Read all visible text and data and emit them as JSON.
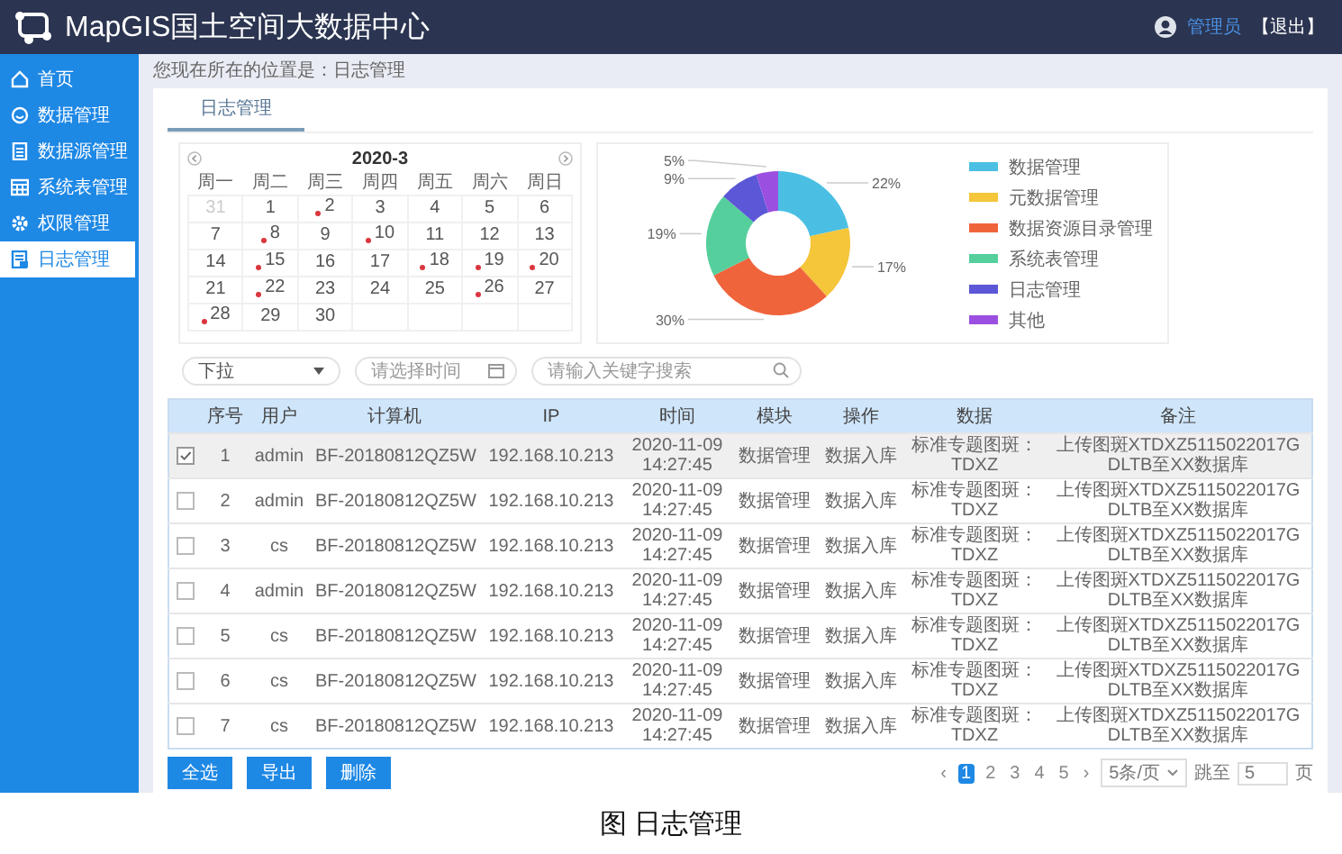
{
  "header": {
    "title": "MapGIS国土空间大数据中心",
    "user": "管理员",
    "logout": "【退出】"
  },
  "sidebar": {
    "items": [
      {
        "label": "首页",
        "selected": false
      },
      {
        "label": "数据管理",
        "selected": false
      },
      {
        "label": "数据源管理",
        "selected": false
      },
      {
        "label": "系统表管理",
        "selected": false
      },
      {
        "label": "权限管理",
        "selected": false
      },
      {
        "label": "日志管理",
        "selected": true
      }
    ]
  },
  "breadcrumb": "您现在所在的位置是：日志管理",
  "tabs": [
    {
      "label": "日志管理",
      "selected": true
    }
  ],
  "calendar": {
    "title": "2020-3",
    "weekdays": [
      "周一",
      "周二",
      "周三",
      "周四",
      "周五",
      "周六",
      "周日"
    ],
    "days": [
      {
        "day": "31",
        "outside": true,
        "marked": false
      },
      {
        "day": "1",
        "outside": false,
        "marked": false
      },
      {
        "day": "2",
        "outside": false,
        "marked": true
      },
      {
        "day": "3",
        "outside": false,
        "marked": false
      },
      {
        "day": "4",
        "outside": false,
        "marked": false
      },
      {
        "day": "5",
        "outside": false,
        "marked": false
      },
      {
        "day": "6",
        "outside": false,
        "marked": false
      },
      {
        "day": "7",
        "outside": false,
        "marked": false
      },
      {
        "day": "8",
        "outside": false,
        "marked": true
      },
      {
        "day": "9",
        "outside": false,
        "marked": false
      },
      {
        "day": "10",
        "outside": false,
        "marked": true
      },
      {
        "day": "11",
        "outside": false,
        "marked": false
      },
      {
        "day": "12",
        "outside": false,
        "marked": false
      },
      {
        "day": "13",
        "outside": false,
        "marked": false
      },
      {
        "day": "14",
        "outside": false,
        "marked": false
      },
      {
        "day": "15",
        "outside": false,
        "marked": true
      },
      {
        "day": "16",
        "outside": false,
        "marked": false
      },
      {
        "day": "17",
        "outside": false,
        "marked": false
      },
      {
        "day": "18",
        "outside": false,
        "marked": true
      },
      {
        "day": "19",
        "outside": false,
        "marked": true
      },
      {
        "day": "20",
        "outside": false,
        "marked": true
      },
      {
        "day": "21",
        "outside": false,
        "marked": false
      },
      {
        "day": "22",
        "outside": false,
        "marked": true
      },
      {
        "day": "23",
        "outside": false,
        "marked": false
      },
      {
        "day": "24",
        "outside": false,
        "marked": false
      },
      {
        "day": "25",
        "outside": false,
        "marked": false
      },
      {
        "day": "26",
        "outside": false,
        "marked": true
      },
      {
        "day": "27",
        "outside": false,
        "marked": false
      },
      {
        "day": "28",
        "outside": false,
        "marked": true
      },
      {
        "day": "29",
        "outside": false,
        "marked": false
      },
      {
        "day": "30",
        "outside": false,
        "marked": false
      }
    ]
  },
  "pie": {
    "chart_data": {
      "type": "donut",
      "categories": [
        "数据管理",
        "元数据管理",
        "数据资源目录管理",
        "系统表管理",
        "日志管理",
        "其他"
      ],
      "values": [
        22,
        17,
        30,
        19,
        9,
        5
      ],
      "colors": [
        "#4bbfe3",
        "#f5c53a",
        "#f0643c",
        "#55cf9c",
        "#5b57d6",
        "#9b4fe0"
      ],
      "value_labels": [
        "22%",
        "17%",
        "30%",
        "19%",
        "9%",
        "5%"
      ]
    }
  },
  "filters": {
    "dropdown": "下拉",
    "date_placeholder": "请选择时间",
    "search_placeholder": "请输入关键字搜索"
  },
  "table": {
    "columns": [
      "序号",
      "用户",
      "计算机",
      "IP",
      "时间",
      "模块",
      "操作",
      "数据",
      "备注"
    ],
    "rows": [
      {
        "checked": true,
        "cells": [
          "1",
          "admin",
          "BF-20180812QZ5W",
          "192.168.10.213",
          "2020-11-09 14:27:45",
          "数据管理",
          "数据入库",
          "标准专题图斑：TDXZ",
          "上传图斑XTDXZ5115022017GDLTB至XX数据库"
        ]
      },
      {
        "checked": false,
        "cells": [
          "2",
          "admin",
          "BF-20180812QZ5W",
          "192.168.10.213",
          "2020-11-09 14:27:45",
          "数据管理",
          "数据入库",
          "标准专题图斑：TDXZ",
          "上传图斑XTDXZ5115022017GDLTB至XX数据库"
        ]
      },
      {
        "checked": false,
        "cells": [
          "3",
          "cs",
          "BF-20180812QZ5W",
          "192.168.10.213",
          "2020-11-09 14:27:45",
          "数据管理",
          "数据入库",
          "标准专题图斑：TDXZ",
          "上传图斑XTDXZ5115022017GDLTB至XX数据库"
        ]
      },
      {
        "checked": false,
        "cells": [
          "4",
          "admin",
          "BF-20180812QZ5W",
          "192.168.10.213",
          "2020-11-09 14:27:45",
          "数据管理",
          "数据入库",
          "标准专题图斑：TDXZ",
          "上传图斑XTDXZ5115022017GDLTB至XX数据库"
        ]
      },
      {
        "checked": false,
        "cells": [
          "5",
          "cs",
          "BF-20180812QZ5W",
          "192.168.10.213",
          "2020-11-09 14:27:45",
          "数据管理",
          "数据入库",
          "标准专题图斑：TDXZ",
          "上传图斑XTDXZ5115022017GDLTB至XX数据库"
        ]
      },
      {
        "checked": false,
        "cells": [
          "6",
          "cs",
          "BF-20180812QZ5W",
          "192.168.10.213",
          "2020-11-09 14:27:45",
          "数据管理",
          "数据入库",
          "标准专题图斑：TDXZ",
          "上传图斑XTDXZ5115022017GDLTB至XX数据库"
        ]
      },
      {
        "checked": false,
        "cells": [
          "7",
          "cs",
          "BF-20180812QZ5W",
          "192.168.10.213",
          "2020-11-09 14:27:45",
          "数据管理",
          "数据入库",
          "标准专题图斑：TDXZ",
          "上传图斑XTDXZ5115022017GDLTB至XX数据库"
        ]
      }
    ]
  },
  "actions": [
    "全选",
    "导出",
    "删除"
  ],
  "pagination": {
    "prev": "‹",
    "pages": [
      {
        "label": "1",
        "selected": true
      },
      {
        "label": "2",
        "selected": false
      },
      {
        "label": "3",
        "selected": false
      },
      {
        "label": "4",
        "selected": false
      },
      {
        "label": "5",
        "selected": false
      }
    ],
    "next": "›",
    "page_size": "5条/页",
    "jump_label": "跳至",
    "jump_value": "5",
    "page_unit": "页"
  },
  "caption": "图 日志管理"
}
